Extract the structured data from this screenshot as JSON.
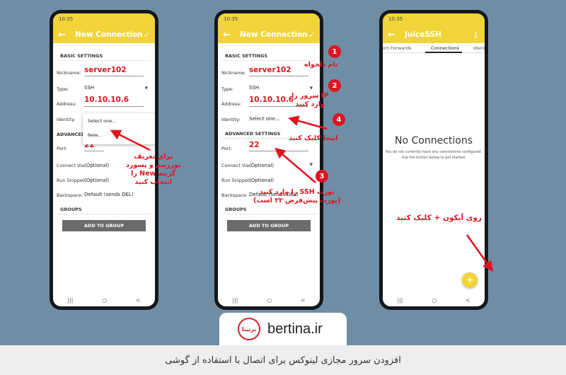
{
  "phones": {
    "p1": {
      "status_time": "10:35",
      "title": "New Connection",
      "basic_settings": "BASIC SETTINGS",
      "nickname_label": "Nickname:",
      "nickname_value": "server102",
      "type_label": "Type:",
      "type_value": "SSH",
      "address_label": "Address:",
      "address_value": "10.10.10.6",
      "identity_label": "Identity:",
      "advanced_settings": "ADVANCED",
      "port_label": "Port:",
      "port_value": "22",
      "connect_via_label": "Connect Via:",
      "connect_via_value": "(Optional)",
      "run_snippet_label": "Run Snippet:",
      "run_snippet_value": "(Optional)",
      "backspace_label": "Backspace:",
      "backspace_value": "Default (sends DEL)",
      "groups": "GROUPS",
      "add_to_group": "ADD TO GROUP",
      "dropdown_opt1": "Select one...",
      "dropdown_opt2": "New..."
    },
    "p2": {
      "status_time": "10:35",
      "title": "New Connection",
      "basic_settings": "BASIC SETTINGS",
      "nickname_label": "Nickname:",
      "nickname_value": "server102",
      "type_label": "Type:",
      "type_value": "SSH",
      "address_label": "Address:",
      "address_value": "10.10.10.6",
      "identity_label": "Identity:",
      "identity_value": "Select one...",
      "advanced_settings": "ADVANCED SETTINGS",
      "port_label": "Port:",
      "port_value": "22",
      "connect_via_label": "Connect Via:",
      "connect_via_value": "(Optional)",
      "run_snippet_label": "Run Snippet:",
      "run_snippet_value": "(Optional)",
      "backspace_label": "Backspace:",
      "backspace_value": "Default (sends DEL)",
      "groups": "GROUPS",
      "add_to_group": "ADD TO GROUP"
    },
    "p3": {
      "status_time": "10:35",
      "title": "JuiceSSH",
      "tab_left": "Port Forwards",
      "tab_active": "Connections",
      "tab_right": "Identities",
      "empty_title": "No Connections",
      "empty_line1": "You do not currently have any connections configured.",
      "empty_line2": "Use the button below to get started.",
      "fab_label": "+"
    }
  },
  "annotations": {
    "a1_line1": "برای تعریف",
    "a1_line2": "یوزرنیم و پسورد",
    "a1_line3": "گزینه New را",
    "a1_line4": "انتخاب کنید",
    "n1": "1",
    "n1_text": "نام دلخواه",
    "n2": "2",
    "n2_line1": "IP سرور را",
    "n2_line2": "وارد کنید",
    "n4": "4",
    "n4_text": "اینجا کلیک کنید",
    "n3": "3",
    "n3_line1": "پورت SSH را وارد کنید",
    "n3_line2": "(پورت پیش‌فرض ۲۲ است)",
    "p3_text": "روی آیکون + کلیک کنید"
  },
  "nav": {
    "recent": "|||",
    "home": "○",
    "back": "<"
  },
  "brand": {
    "name": "bertina.ir",
    "badge": "برتینا"
  },
  "footer": {
    "caption": "افزودن سرور مجازی لینوکس برای اتصال با استفاده از گوشی"
  },
  "colors": {
    "accent": "#f2d43a",
    "annotation_red": "#e0141e",
    "background": "#6f8ea6"
  }
}
